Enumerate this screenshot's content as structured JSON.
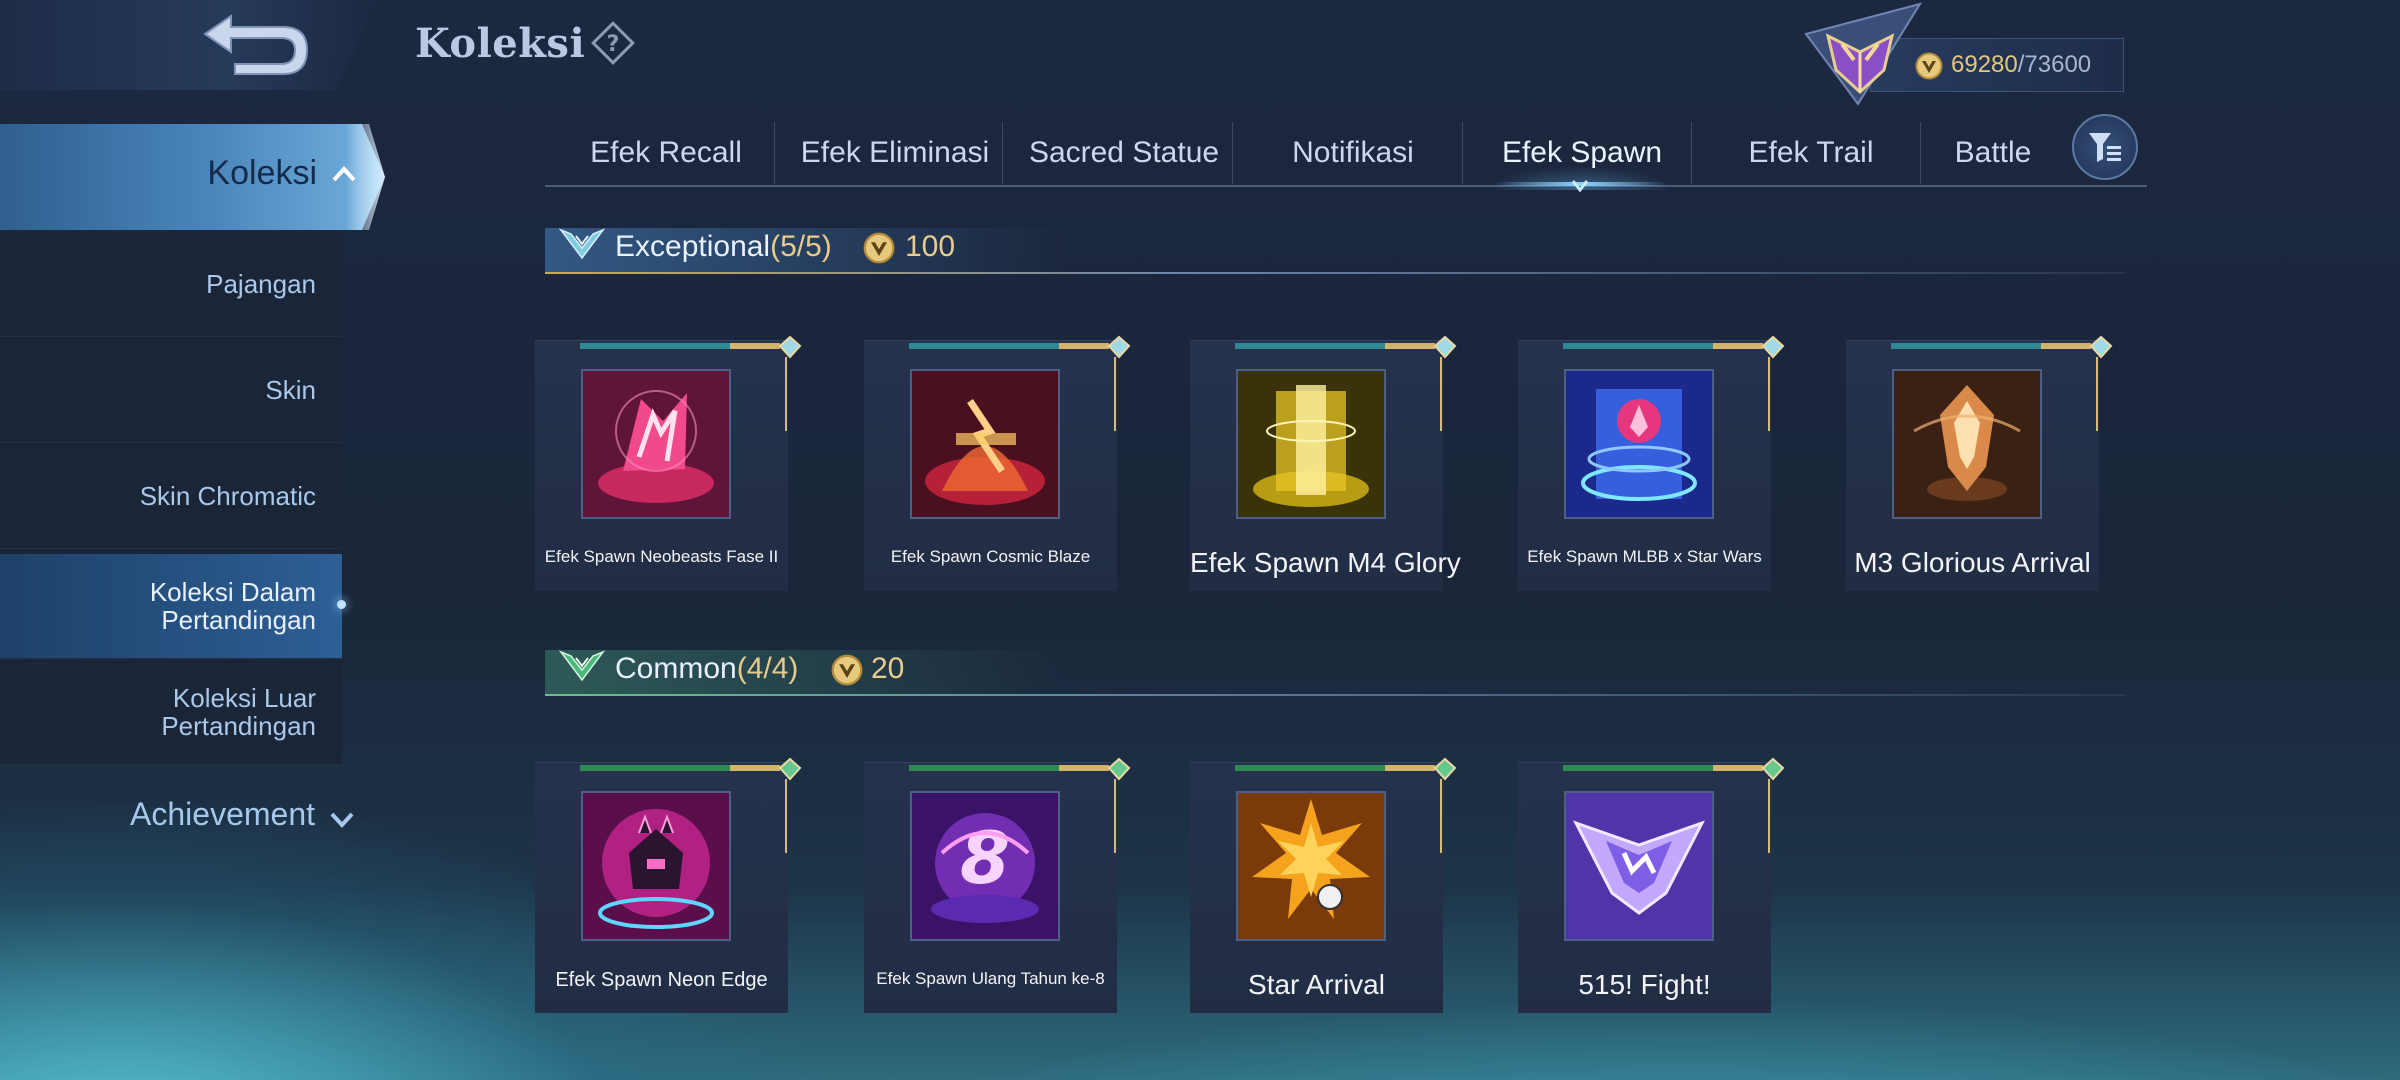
{
  "header": {
    "title": "Koleksi",
    "points_current": "69280",
    "points_max": "/73600",
    "help_icon": "question-diamond-icon",
    "back_icon": "back-arrow-icon"
  },
  "sidebar": {
    "koleksi_label": "Koleksi",
    "items": [
      {
        "label": "Pajangan"
      },
      {
        "label": "Skin"
      },
      {
        "label": "Skin Chromatic"
      },
      {
        "label": "Koleksi Dalam Pertandingan"
      },
      {
        "label": "Koleksi Luar Pertandingan"
      }
    ],
    "achievement_label": "Achievement"
  },
  "tabs": [
    {
      "label": "Efek Recall"
    },
    {
      "label": "Efek Eliminasi"
    },
    {
      "label": "Sacred Statue"
    },
    {
      "label": "Notifikasi"
    },
    {
      "label": "Efek Spawn"
    },
    {
      "label": "Efek Trail"
    },
    {
      "label": "Battle"
    }
  ],
  "active_tab": "Efek Spawn",
  "sections": {
    "exceptional": {
      "name": "Exceptional",
      "count": "(5/5)",
      "points": "100",
      "items": [
        {
          "name": "Efek Spawn Neobeasts Fase II"
        },
        {
          "name": "Efek Spawn Cosmic Blaze"
        },
        {
          "name": "Efek Spawn M4 Glory"
        },
        {
          "name": "Efek Spawn MLBB x Star Wars"
        },
        {
          "name": "M3 Glorious Arrival"
        }
      ]
    },
    "common": {
      "name": "Common",
      "count": "(4/4)",
      "points": "20",
      "items": [
        {
          "name": "Efek Spawn Neon Edge"
        },
        {
          "name": "Efek Spawn Ulang Tahun ke-8"
        },
        {
          "name": "Star Arrival"
        },
        {
          "name": "515! Fight!"
        }
      ]
    }
  },
  "colors": {
    "accent_gold": "#e4c77f",
    "tab_active_glow": "#8ad3ff",
    "sidebar_active": "#2d5f95"
  }
}
